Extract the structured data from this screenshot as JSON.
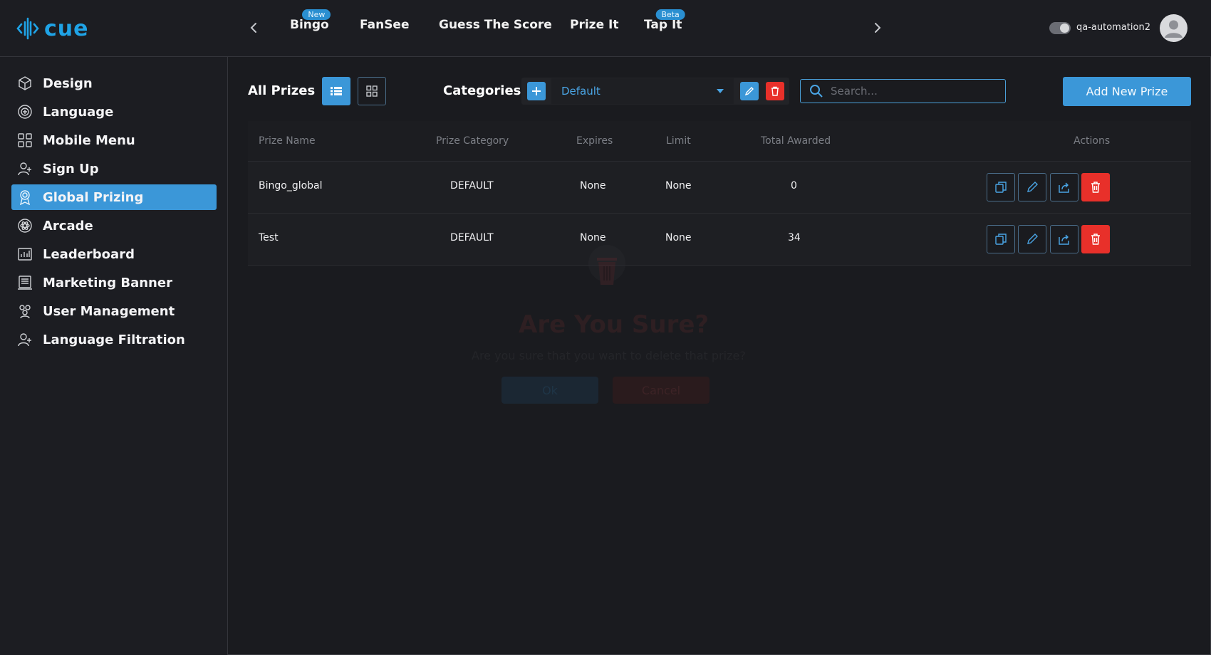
{
  "brand": {
    "logo_text": "cue",
    "accent": "#3b97d8",
    "danger": "#e8302a"
  },
  "topnav": {
    "tabs": [
      {
        "label": "Bingo",
        "badge": "New"
      },
      {
        "label": "FanSee",
        "badge": ""
      },
      {
        "label": "Guess The Score",
        "badge": ""
      },
      {
        "label": "Prize It",
        "badge": ""
      },
      {
        "label": "Tap It",
        "badge": "Beta"
      }
    ],
    "user": {
      "name": "qa-automation2"
    }
  },
  "sidebar": {
    "items": [
      {
        "label": "Design",
        "icon": "cube-icon",
        "active": false
      },
      {
        "label": "Language",
        "icon": "language-icon",
        "active": false
      },
      {
        "label": "Mobile Menu",
        "icon": "grid-icon",
        "active": false
      },
      {
        "label": "Sign Up",
        "icon": "user-plus-icon",
        "active": false
      },
      {
        "label": "Global Prizing",
        "icon": "award-icon",
        "active": true
      },
      {
        "label": "Arcade",
        "icon": "atom-icon",
        "active": false
      },
      {
        "label": "Leaderboard",
        "icon": "leaderboard-icon",
        "active": false
      },
      {
        "label": "Marketing Banner",
        "icon": "banner-icon",
        "active": false
      },
      {
        "label": "User Management",
        "icon": "users-icon",
        "active": false
      },
      {
        "label": "Language Filtration",
        "icon": "user-plus-icon",
        "active": false
      }
    ]
  },
  "toolbar": {
    "all_prizes_label": "All Prizes",
    "categories_label": "Categories",
    "category_selected": "Default",
    "search_placeholder": "Search...",
    "add_prize_label": "Add New Prize"
  },
  "table": {
    "headers": [
      "Prize Name",
      "Prize Category",
      "Expires",
      "Limit",
      "Total Awarded",
      "Actions"
    ],
    "rows": [
      {
        "name": "Bingo_global",
        "category": "DEFAULT",
        "expires": "None",
        "limit": "None",
        "awarded": "0"
      },
      {
        "name": "Test",
        "category": "DEFAULT",
        "expires": "None",
        "limit": "None",
        "awarded": "34"
      }
    ]
  },
  "dialog": {
    "title": "Are You Sure?",
    "message": "Are you sure that you want to delete that prize?",
    "ok_label": "Ok",
    "cancel_label": "Cancel"
  }
}
